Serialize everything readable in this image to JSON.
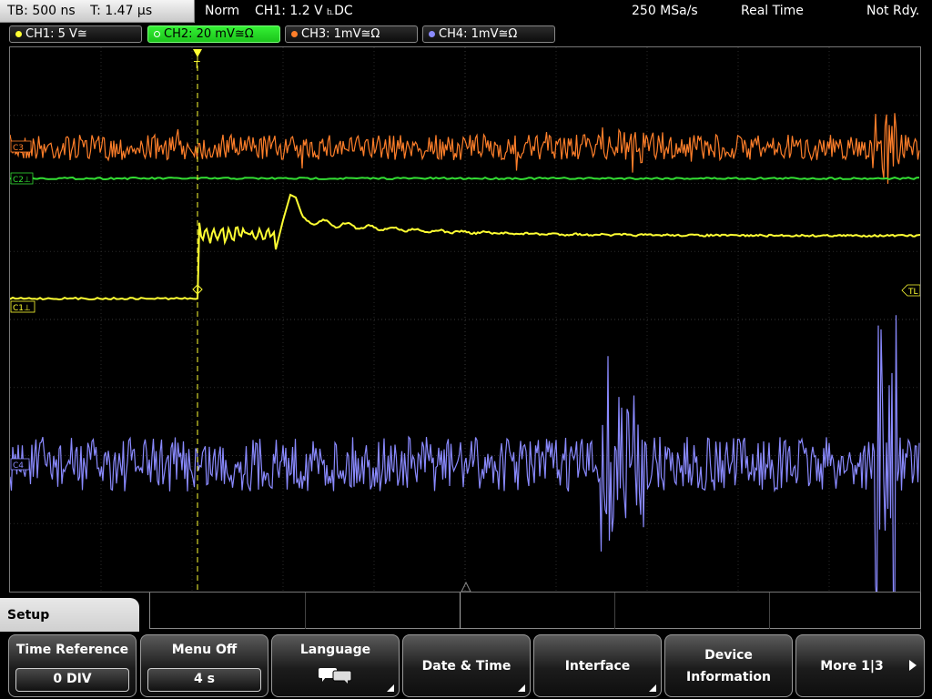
{
  "topbar": {
    "timebase": "TB: 500 ns",
    "trigger_time": "T: 1.47 µs",
    "mode": "Norm",
    "trigger_info": "CH1: 1.2 V ⦜DC",
    "sample_rate": "250 MSa/s",
    "acq_mode": "Real Time",
    "status": "Not Rdy."
  },
  "channels": [
    {
      "label": "CH1: 5 V≅",
      "color": "#ffff33",
      "active": false
    },
    {
      "label": "CH2: 20 mV≅Ω",
      "color": "#33dd33",
      "active": true
    },
    {
      "label": "CH3: 1mV≅Ω",
      "color": "#ff7f2a",
      "active": false
    },
    {
      "label": "CH4: 1mV≅Ω",
      "color": "#8a8aff",
      "active": false
    }
  ],
  "markers": {
    "ch1": "C1⊥",
    "ch2": "C2⊥",
    "ch3": "C3",
    "ch4": "C4",
    "trigger_level": "TL",
    "trigger_pos": "T"
  },
  "trace_colors": {
    "ch1": "#ffff33",
    "ch2": "#33dd33",
    "ch3": "#ff7f2a",
    "ch4": "#8a8aff"
  },
  "menu": {
    "title": "Setup",
    "buttons": [
      {
        "label": "Time Reference",
        "value": "0 DIV"
      },
      {
        "label": "Menu Off",
        "value": "4 s"
      },
      {
        "label": "Language"
      },
      {
        "label": "Date & Time"
      },
      {
        "label": "Interface"
      },
      {
        "label": "Device",
        "label2": "Information"
      },
      {
        "label": "More 1|3"
      }
    ]
  }
}
